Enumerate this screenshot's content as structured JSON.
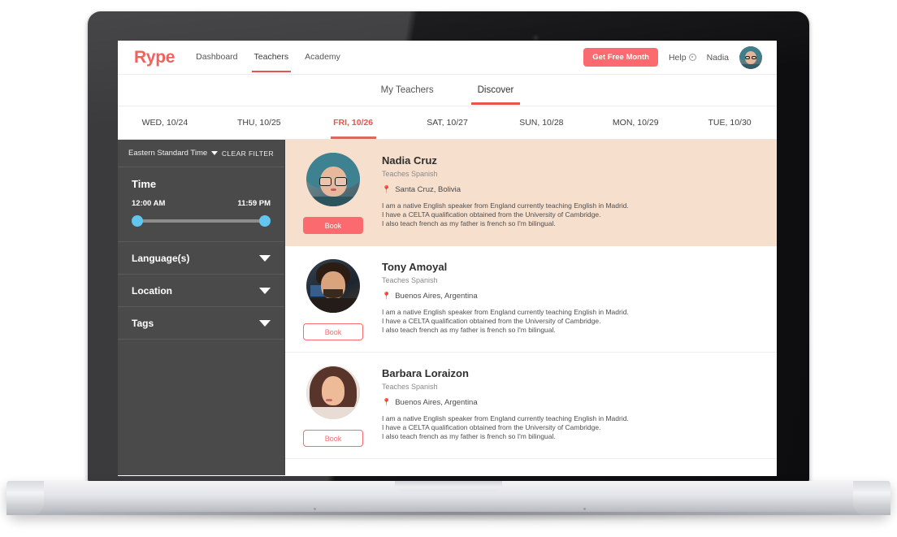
{
  "brand": {
    "name": "Rype"
  },
  "header": {
    "nav": [
      {
        "label": "Dashboard",
        "active": false
      },
      {
        "label": "Teachers",
        "active": true
      },
      {
        "label": "Academy",
        "active": false
      }
    ],
    "cta_label": "Get Free Month",
    "help_label": "Help",
    "help_icon": "gear-icon",
    "user_name": "Nadia",
    "avatar_icon": "user-avatar"
  },
  "tabs": [
    {
      "label": "My Teachers",
      "active": false
    },
    {
      "label": "Discover",
      "active": true
    }
  ],
  "dates": [
    {
      "label": "WED, 10/24",
      "active": false
    },
    {
      "label": "THU, 10/25",
      "active": false
    },
    {
      "label": "FRI, 10/26",
      "active": true
    },
    {
      "label": "SAT, 10/27",
      "active": false
    },
    {
      "label": "SUN, 10/28",
      "active": false
    },
    {
      "label": "MON, 10/29",
      "active": false
    },
    {
      "label": "TUE, 10/30",
      "active": false
    }
  ],
  "sidebar": {
    "timezone": "Eastern Standard Time",
    "timezone_caret_icon": "chevron-down-icon",
    "clear_filter_label": "CLEAR FILTER",
    "time": {
      "title": "Time",
      "min_label": "12:00 AM",
      "max_label": "11:59 PM"
    },
    "sections": [
      {
        "label": "Language(s)",
        "caret_icon": "chevron-down-icon"
      },
      {
        "label": "Location",
        "caret_icon": "chevron-down-icon"
      },
      {
        "label": "Tags",
        "caret_icon": "chevron-down-icon"
      }
    ]
  },
  "teachers": [
    {
      "name": "Nadia Cruz",
      "teaches": "Teaches Spanish",
      "location": "Santa Cruz, Bolivia",
      "location_icon": "map-pin-icon",
      "bio": [
        "I am a native English speaker from England currently teaching English in Madrid.",
        "I have a CELTA qualification obtained from the University of Cambridge.",
        "I also teach french as my father is french so I'm bilingual."
      ],
      "book_label": "Book",
      "book_style": "filled",
      "highlighted": true
    },
    {
      "name": "Tony Amoyal",
      "teaches": "Teaches Spanish",
      "location": "Buenos Aires, Argentina",
      "location_icon": "map-pin-icon",
      "bio": [
        "I am a native English speaker from England currently teaching English in Madrid.",
        "I have a CELTA qualification obtained from the University of Cambridge.",
        "I also teach french as my father is french so I'm bilingual."
      ],
      "book_label": "Book",
      "book_style": "outline",
      "highlighted": false
    },
    {
      "name": "Barbara Loraizon",
      "teaches": "Teaches Spanish",
      "location": "Buenos Aires, Argentina",
      "location_icon": "map-pin-icon",
      "bio": [
        "I am a native English speaker from England currently teaching English in Madrid.",
        "I have a CELTA qualification obtained from the University of Cambridge.",
        "I also teach french as my father is french so I'm bilingual."
      ],
      "book_label": "Book",
      "book_style": "outline",
      "highlighted": false
    }
  ],
  "colors": {
    "brand_coral": "#f2615c",
    "accent_coral": "#fa6a6e",
    "active_underline": "#e8554e",
    "sidebar_bg": "#4a4a4a",
    "slider_handle": "#63c6ef",
    "highlight_row": "#f7dfcd"
  }
}
